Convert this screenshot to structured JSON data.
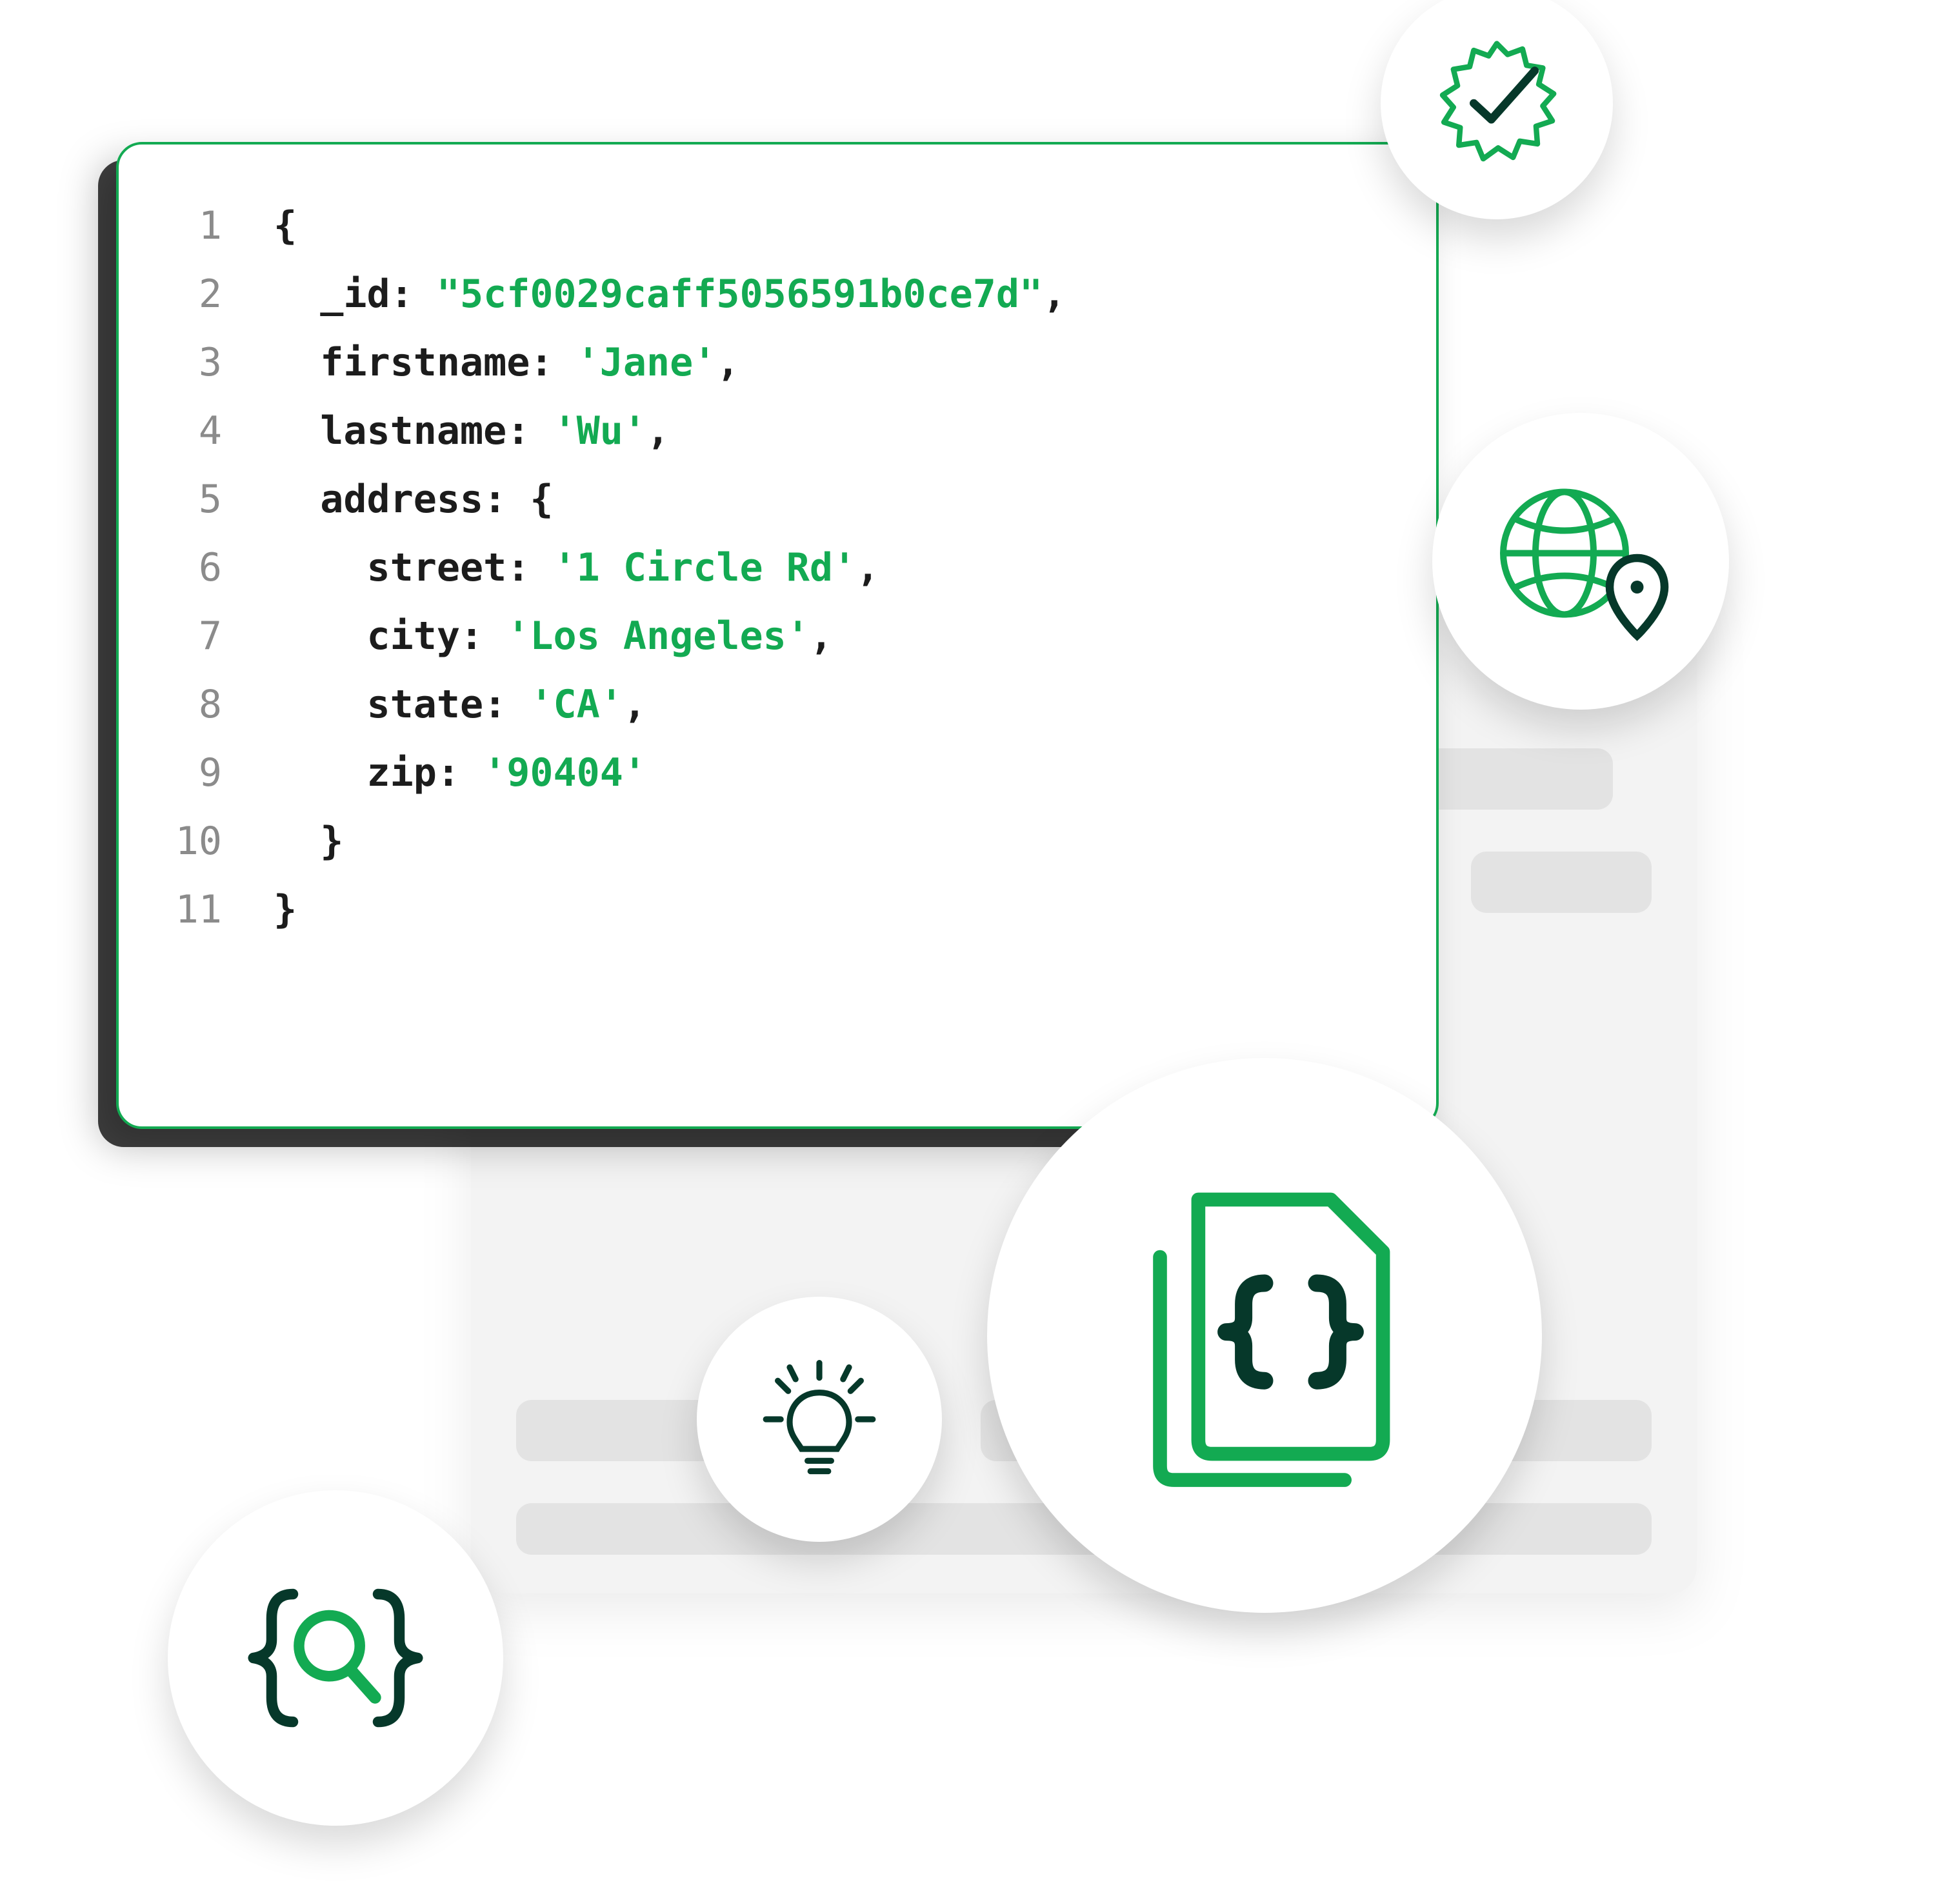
{
  "code": {
    "indent_unit": "  ",
    "lines": [
      {
        "n": 1,
        "depth": 0,
        "kind": "open"
      },
      {
        "n": 2,
        "depth": 1,
        "kind": "kv",
        "key": "_id",
        "value": "\"5cf0029caff5056591b0ce7d\"",
        "comma": true
      },
      {
        "n": 3,
        "depth": 1,
        "kind": "kv",
        "key": "firstname",
        "value": "'Jane'",
        "comma": true
      },
      {
        "n": 4,
        "depth": 1,
        "kind": "kv",
        "key": "lastname",
        "value": "'Wu'",
        "comma": true
      },
      {
        "n": 5,
        "depth": 1,
        "kind": "kopen",
        "key": "address"
      },
      {
        "n": 6,
        "depth": 2,
        "kind": "kv",
        "key": "street",
        "value": "'1 Circle Rd'",
        "comma": true
      },
      {
        "n": 7,
        "depth": 2,
        "kind": "kv",
        "key": "city",
        "value": "'Los Angeles'",
        "comma": true
      },
      {
        "n": 8,
        "depth": 2,
        "kind": "kv",
        "key": "state",
        "value": "'CA'",
        "comma": true
      },
      {
        "n": 9,
        "depth": 2,
        "kind": "kv",
        "key": "zip",
        "value": "'90404'",
        "comma": false
      },
      {
        "n": 10,
        "depth": 1,
        "kind": "close"
      },
      {
        "n": 11,
        "depth": 0,
        "kind": "close"
      }
    ]
  },
  "icons": {
    "verified_badge": "verified-badge-icon",
    "globe_location": "globe-location-icon",
    "document_stack": "document-stack-icon",
    "lightbulb": "lightbulb-icon",
    "braces_search": "braces-search-icon"
  },
  "colors": {
    "accent": "#13aa52",
    "accent_dark": "#0f5132",
    "deep": "#06382a"
  }
}
